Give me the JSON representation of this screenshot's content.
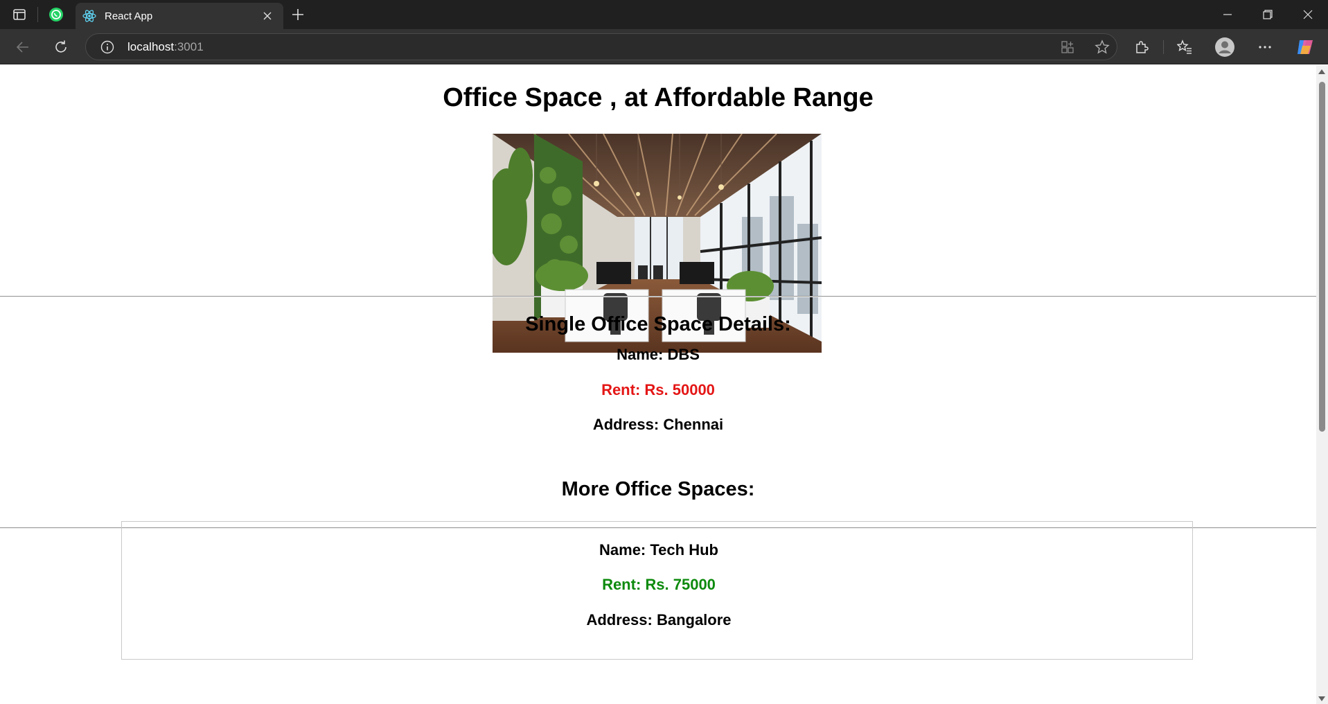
{
  "browser": {
    "tab": {
      "title": "React App"
    },
    "address": {
      "host": "localhost",
      "port": ":3001"
    }
  },
  "page": {
    "title": "Office Space , at Affordable Range",
    "single_section": {
      "heading": "Single Office Space Details:",
      "name": "Name: DBS",
      "rent": "Rent: Rs. 50000",
      "address": "Address: Chennai"
    },
    "more_section": {
      "heading": "More Office Spaces:",
      "items": [
        {
          "name": "Name: Tech Hub",
          "rent": "Rent: Rs. 75000",
          "address": "Address: Bangalore"
        }
      ]
    }
  },
  "colors": {
    "rent_high": "#e41616",
    "rent_ok": "#0d8a0d"
  }
}
